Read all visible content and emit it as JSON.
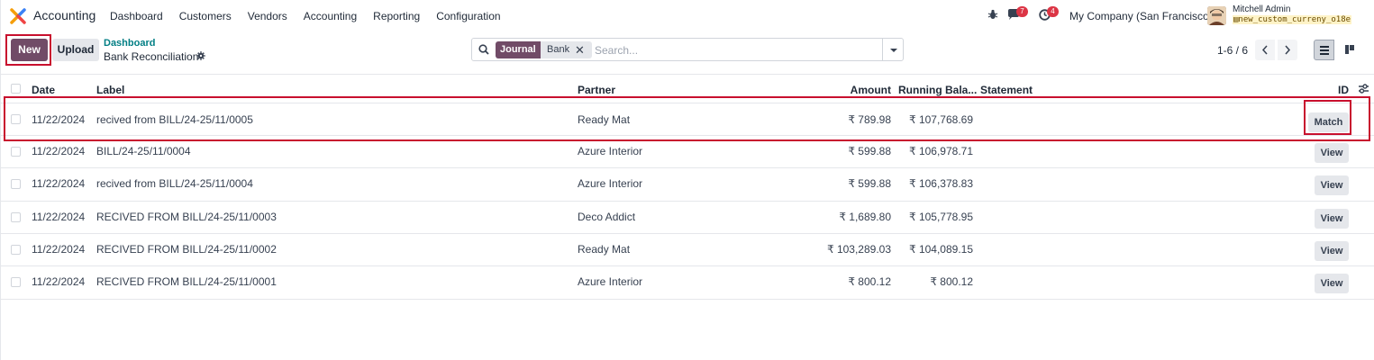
{
  "navbar": {
    "app_name": "Accounting",
    "menu": [
      "Dashboard",
      "Customers",
      "Vendors",
      "Accounting",
      "Reporting",
      "Configuration"
    ],
    "chat_badge": "7",
    "activity_badge": "4",
    "company": "My Company (San Francisco)",
    "user_name": "Mitchell Admin",
    "database": "new_custom_curreny_o18e",
    "badge_color": "#dc3545",
    "brand_color": "#714b67"
  },
  "control_panel": {
    "new_label": "New",
    "upload_label": "Upload",
    "breadcrumb_parent": "Dashboard",
    "breadcrumb_current": "Bank Reconciliation",
    "search": {
      "facet_label": "Journal",
      "facet_value": "Bank",
      "placeholder": "Search..."
    },
    "pager": "1-6 / 6"
  },
  "table": {
    "headers": {
      "date": "Date",
      "label": "Label",
      "partner": "Partner",
      "amount": "Amount",
      "running_balance": "Running Bala...",
      "statement": "Statement",
      "id": "ID"
    },
    "rows": [
      {
        "date": "11/22/2024",
        "label": "recived from BILL/24-25/11/0005",
        "partner": "Ready Mat",
        "amount": "₹ 789.98",
        "balance": "₹ 107,768.69",
        "action": "Match"
      },
      {
        "date": "11/22/2024",
        "label": "BILL/24-25/11/0004",
        "partner": "Azure Interior",
        "amount": "₹ 599.88",
        "balance": "₹ 106,978.71",
        "action": "View"
      },
      {
        "date": "11/22/2024",
        "label": "recived from BILL/24-25/11/0004",
        "partner": "Azure Interior",
        "amount": "₹ 599.88",
        "balance": "₹ 106,378.83",
        "action": "View"
      },
      {
        "date": "11/22/2024",
        "label": "RECIVED FROM BILL/24-25/11/0003",
        "partner": "Deco Addict",
        "amount": "₹ 1,689.80",
        "balance": "₹ 105,778.95",
        "action": "View"
      },
      {
        "date": "11/22/2024",
        "label": "RECIVED FROM BILL/24-25/11/0002",
        "partner": "Ready Mat",
        "amount": "₹ 103,289.03",
        "balance": "₹ 104,089.15",
        "action": "View"
      },
      {
        "date": "11/22/2024",
        "label": "RECIVED FROM BILL/24-25/11/0001",
        "partner": "Azure Interior",
        "amount": "₹ 800.12",
        "balance": "₹ 800.12",
        "action": "View"
      }
    ]
  }
}
